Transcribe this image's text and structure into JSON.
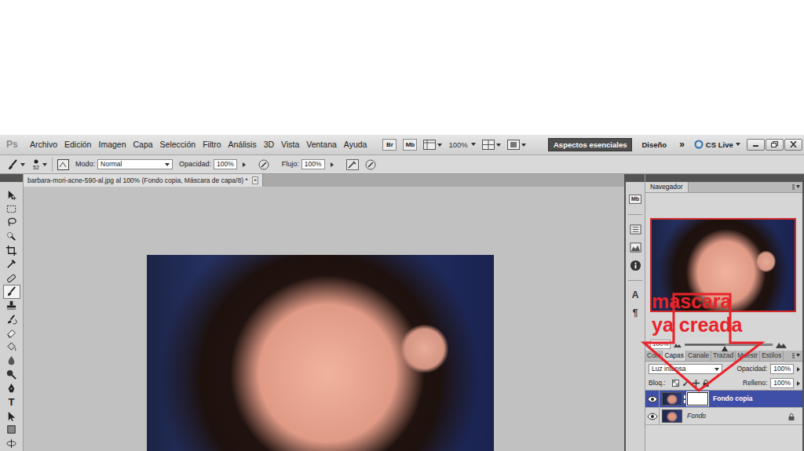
{
  "app": {
    "logo": "Ps"
  },
  "menu": [
    "Archivo",
    "Edición",
    "Imagen",
    "Capa",
    "Selección",
    "Filtro",
    "Análisis",
    "3D",
    "Vista",
    "Ventana",
    "Ayuda"
  ],
  "app_bar": {
    "bridge": "Br",
    "mini_bridge": "Mb",
    "zoom": "100%",
    "workspaces": [
      {
        "label": "Aspectos esenciales",
        "selected": true
      },
      {
        "label": "Diseño",
        "selected": false
      }
    ],
    "more": "»",
    "cs_live": "CS Live"
  },
  "options": {
    "brush_size": "52",
    "mode_label": "Modo:",
    "mode": "Normal",
    "opacity_label": "Opacidad:",
    "opacity": "100%",
    "flow_label": "Flujo:",
    "flow": "100%"
  },
  "tools": [
    {
      "kind": "move",
      "selected": false
    },
    {
      "kind": "marquee",
      "selected": false
    },
    {
      "kind": "lasso",
      "selected": false
    },
    {
      "kind": "quick-select",
      "selected": false
    },
    {
      "kind": "crop",
      "selected": false
    },
    {
      "kind": "eyedropper",
      "selected": false
    },
    {
      "kind": "healing",
      "selected": false
    },
    {
      "kind": "brush",
      "selected": true
    },
    {
      "kind": "stamp",
      "selected": false
    },
    {
      "kind": "history",
      "selected": false
    },
    {
      "kind": "eraser",
      "selected": false
    },
    {
      "kind": "bucket",
      "selected": false
    },
    {
      "kind": "blur",
      "selected": false
    },
    {
      "kind": "dodge",
      "selected": false
    },
    {
      "kind": "pen",
      "selected": false
    },
    {
      "kind": "type",
      "glyph": "T",
      "selected": false
    },
    {
      "kind": "path-select",
      "selected": false
    },
    {
      "kind": "shape",
      "selected": false
    },
    {
      "kind": "rotate-3d",
      "selected": false
    }
  ],
  "document": {
    "title": "barbara-mori-acne-590-al.jpg al 100% (Fondo copia, Máscara de capa/8) *",
    "close": "×"
  },
  "dock": [
    {
      "kind": "mini-bridge",
      "glyph": "Mb"
    },
    {
      "kind": "history"
    },
    {
      "kind": "histogram"
    },
    {
      "kind": "info"
    },
    {
      "kind": "character",
      "glyph": "A"
    },
    {
      "kind": "paragraph",
      "glyph": "¶"
    }
  ],
  "navigator": {
    "title": "Navegador",
    "zoom": "100%",
    "level": 0.45
  },
  "annotation": {
    "lines": [
      "mascara",
      "ya creada"
    ]
  },
  "layers_panel": {
    "tabs": [
      {
        "label": "Colo",
        "selected": false
      },
      {
        "label": "Capas",
        "selected": true
      },
      {
        "label": "Canale",
        "selected": false
      },
      {
        "label": "Trazad",
        "selected": false
      },
      {
        "label": "Muestr",
        "selected": false
      },
      {
        "label": "Estilos",
        "selected": false
      }
    ],
    "blend_mode": "Luz intensa",
    "opacity_label": "Opacidad:",
    "opacity": "100%",
    "lock_label": "Bloq.:",
    "fill_label": "Relleno:",
    "fill": "100%",
    "layers": [
      {
        "name": "Fondo copia",
        "selected": true,
        "visible": true,
        "has_mask": true,
        "locked": false
      },
      {
        "name": "Fondo",
        "selected": false,
        "visible": true,
        "has_mask": false,
        "locked": true
      }
    ]
  }
}
